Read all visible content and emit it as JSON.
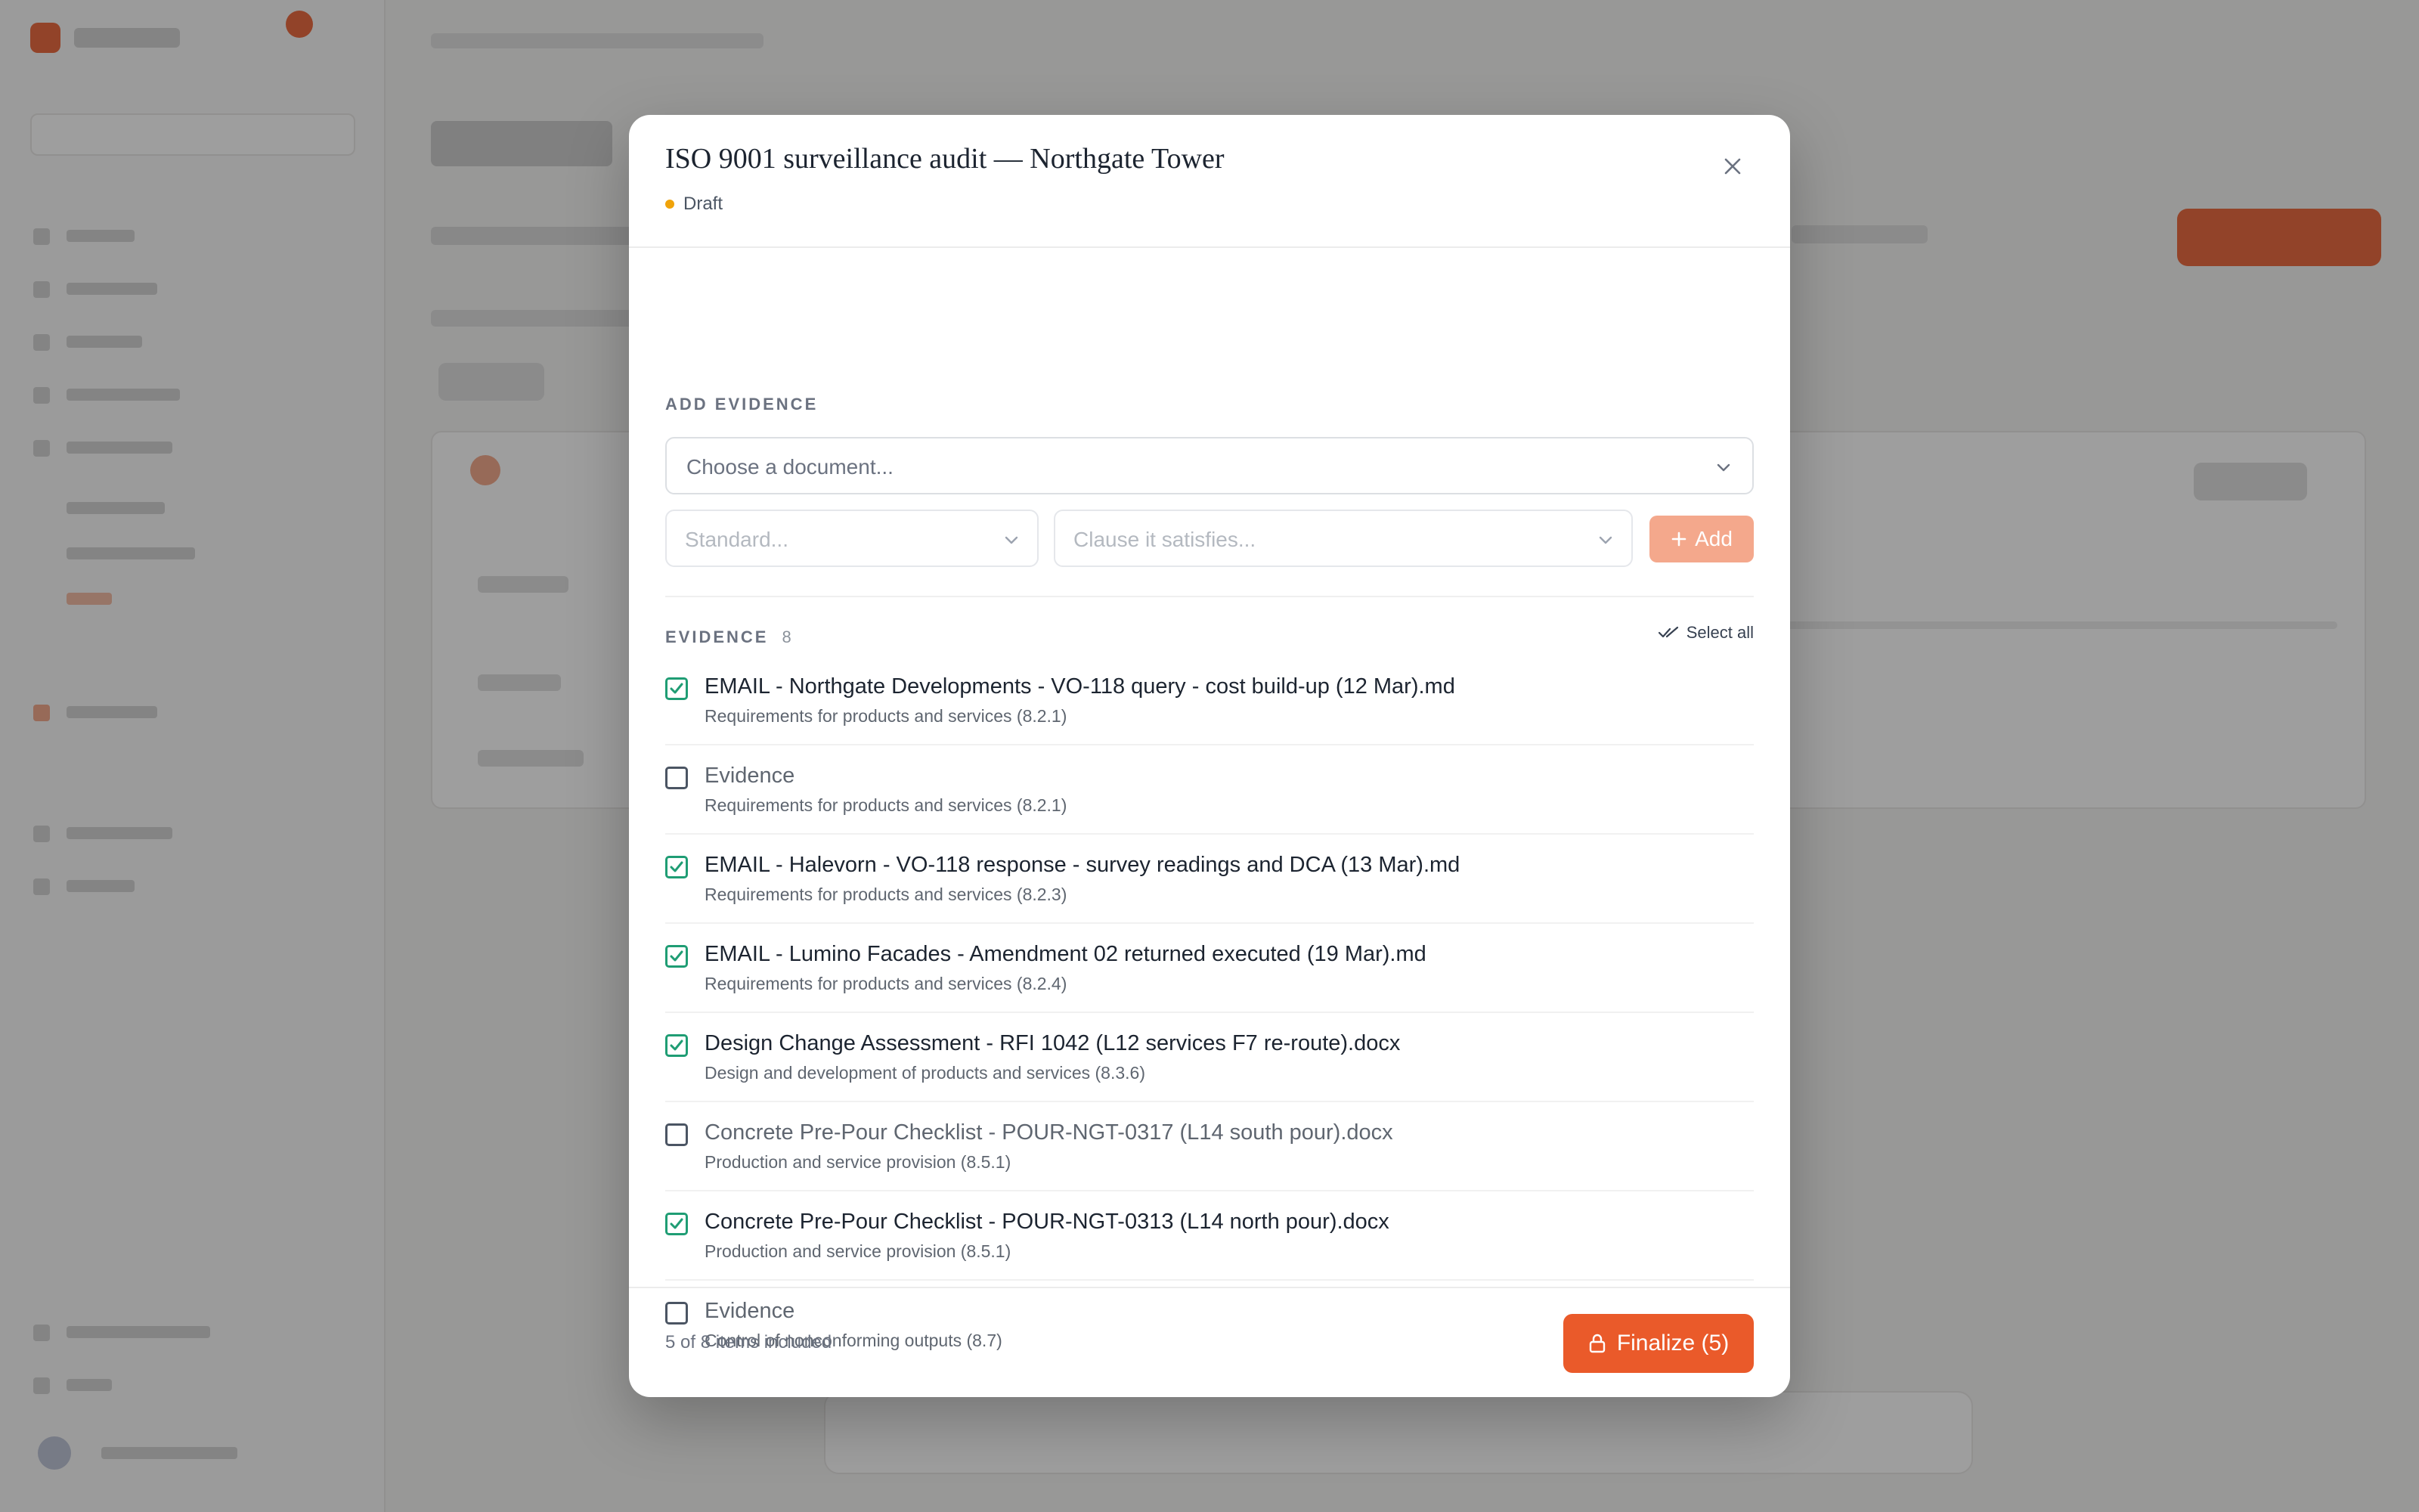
{
  "modal": {
    "title": "ISO 9001 surveillance audit — Northgate Tower",
    "status": "Draft",
    "add_section_label": "ADD EVIDENCE",
    "document_placeholder": "Choose a document...",
    "standard_placeholder": "Standard...",
    "clause_placeholder": "Clause it satisfies...",
    "add_label": "Add",
    "evidence_label": "EVIDENCE",
    "evidence_count": "8",
    "select_all_label": "Select all",
    "items": [
      {
        "title": "EMAIL - Northgate Developments - VO-118 query - cost build-up (12 Mar).md",
        "clause": "Requirements for products and services (8.2.1)",
        "checked": true
      },
      {
        "title": "Evidence",
        "clause": "Requirements for products and services (8.2.1)",
        "checked": false
      },
      {
        "title": "EMAIL - Halevorn - VO-118 response - survey readings and DCA (13 Mar).md",
        "clause": "Requirements for products and services (8.2.3)",
        "checked": true
      },
      {
        "title": "EMAIL - Lumino Facades - Amendment 02 returned executed (19 Mar).md",
        "clause": "Requirements for products and services (8.2.4)",
        "checked": true
      },
      {
        "title": "Design Change Assessment - RFI 1042 (L12 services F7 re-route).docx",
        "clause": "Design and development of products and services (8.3.6)",
        "checked": true
      },
      {
        "title": "Concrete Pre-Pour Checklist - POUR-NGT-0317 (L14 south pour).docx",
        "clause": "Production and service provision (8.5.1)",
        "checked": false
      },
      {
        "title": "Concrete Pre-Pour Checklist - POUR-NGT-0313 (L14 north pour).docx",
        "clause": "Production and service provision (8.5.1)",
        "checked": true
      },
      {
        "title": "Evidence",
        "clause": "Control of nonconforming outputs (8.7)",
        "checked": false
      }
    ],
    "footer_count": "5 of 8 items included",
    "finalize_label": "Finalize (5)"
  },
  "colors": {
    "accent": "#ea5a2a",
    "checked": "#1f9d74",
    "status_draft": "#f0a30a"
  }
}
